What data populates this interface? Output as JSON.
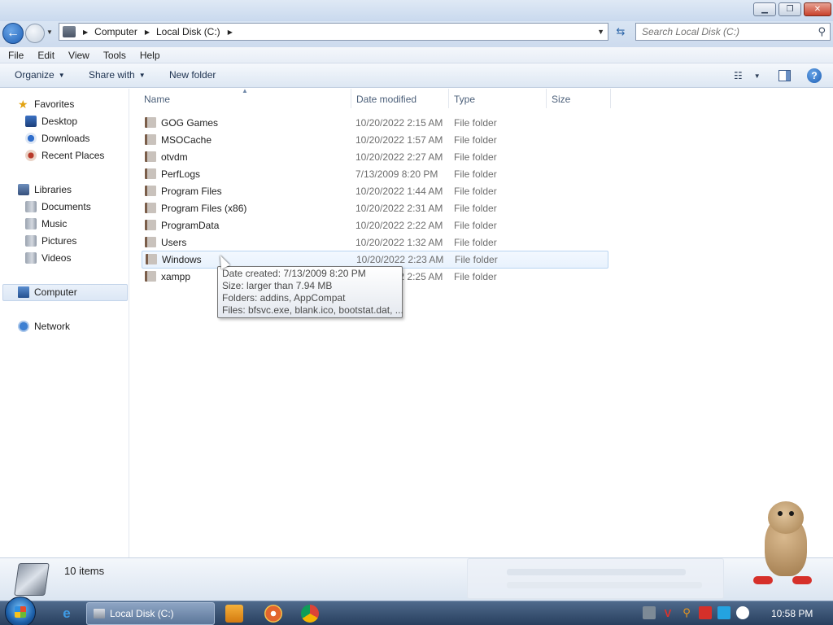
{
  "window": {
    "minimize_glyph": "▁",
    "maximize_glyph": "❐",
    "close_glyph": "✕"
  },
  "address": {
    "breadcrumbs": [
      "Computer",
      "Local Disk (C:)"
    ],
    "back_glyph": "←",
    "refresh_glyph": "⇆",
    "search_placeholder": "Search Local Disk (C:)"
  },
  "menubar": {
    "items": [
      "File",
      "Edit",
      "View",
      "Tools",
      "Help"
    ]
  },
  "commandbar": {
    "organize": "Organize",
    "share_with": "Share with",
    "new_folder": "New folder",
    "views_glyph": "☷",
    "help_glyph": "?"
  },
  "navpane": {
    "favorites": {
      "label": "Favorites",
      "items": [
        "Desktop",
        "Downloads",
        "Recent Places"
      ]
    },
    "libraries": {
      "label": "Libraries",
      "items": [
        "Documents",
        "Music",
        "Pictures",
        "Videos"
      ]
    },
    "computer": "Computer",
    "network": "Network",
    "selected": "Computer"
  },
  "filelist": {
    "columns": [
      "Name",
      "Date modified",
      "Type",
      "Size"
    ],
    "rows": [
      {
        "name": "GOG Games",
        "date": "10/20/2022 2:15 AM",
        "type": "File folder"
      },
      {
        "name": "MSOCache",
        "date": "10/20/2022 1:57 AM",
        "type": "File folder"
      },
      {
        "name": "otvdm",
        "date": "10/20/2022 2:27 AM",
        "type": "File folder"
      },
      {
        "name": "PerfLogs",
        "date": "7/13/2009 8:20 PM",
        "type": "File folder"
      },
      {
        "name": "Program Files",
        "date": "10/20/2022 1:44 AM",
        "type": "File folder"
      },
      {
        "name": "Program Files (x86)",
        "date": "10/20/2022 2:31 AM",
        "type": "File folder"
      },
      {
        "name": "ProgramData",
        "date": "10/20/2022 2:22 AM",
        "type": "File folder"
      },
      {
        "name": "Users",
        "date": "10/20/2022 1:32 AM",
        "type": "File folder"
      },
      {
        "name": "Windows",
        "date": "10/20/2022 2:23 AM",
        "type": "File folder"
      },
      {
        "name": "xampp",
        "date": "10/20/2022 2:25 AM",
        "type": "File folder"
      }
    ],
    "hovered": "Windows"
  },
  "tooltip": {
    "lines": [
      "Date created: 7/13/2009 8:20 PM",
      "Size: larger than 7.94 MB",
      "Folders: addins, AppCompat",
      "Files: bfsvc.exe, blank.ico, bootstat.dat, ..."
    ]
  },
  "details": {
    "item_count": "10 items"
  },
  "taskbar": {
    "ie_glyph": "e",
    "active_window": "Local Disk (C:)",
    "clock": "10:58 PM",
    "tray_icons": [
      "network-icon",
      "antivirus-icon",
      "search-tool-icon",
      "flag-icon",
      "display-icon",
      "volume-icon"
    ]
  },
  "colors": {
    "titlebar": "#c9d9ee",
    "hover_row": "#e8f2fd",
    "taskbar": "#283f5e"
  }
}
